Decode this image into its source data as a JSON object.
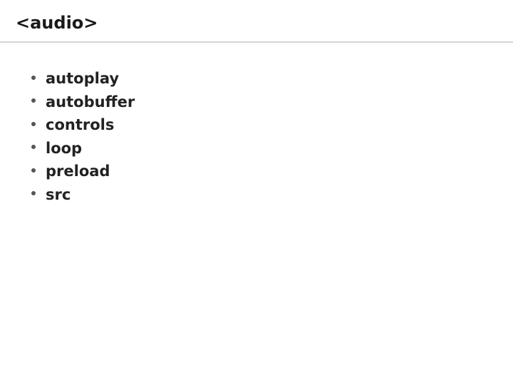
{
  "title": "<audio>",
  "attributes": [
    "autoplay",
    "autobuffer",
    "controls",
    "loop",
    "preload",
    "src"
  ]
}
